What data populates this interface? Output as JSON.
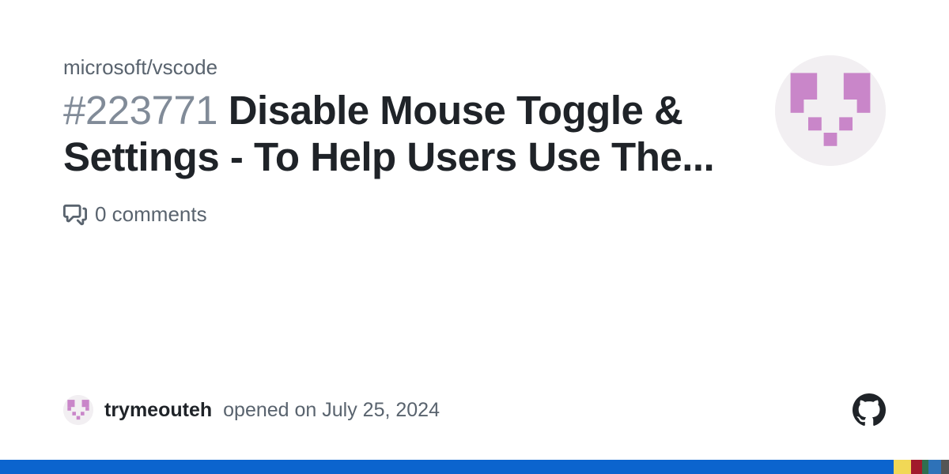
{
  "repo": "microsoft/vscode",
  "issue_number": "#223771",
  "issue_title": "Disable Mouse Toggle & Settings - To Help Users Use The...",
  "comments_count": "0 comments",
  "author": "trymeouteh",
  "opened_text": "opened on July 25, 2024",
  "avatar_pixel_color": "#c986c9",
  "avatar_bg": "#f2eff2",
  "bottom_bar": {
    "blue": "#0b64ce",
    "segments": [
      {
        "color": "#f1d856",
        "width": 22
      },
      {
        "color": "#a11a2b",
        "width": 14
      },
      {
        "color": "#2f6f4f",
        "width": 8
      },
      {
        "color": "#2e72b8",
        "width": 16
      },
      {
        "color": "#555555",
        "width": 10
      }
    ]
  }
}
